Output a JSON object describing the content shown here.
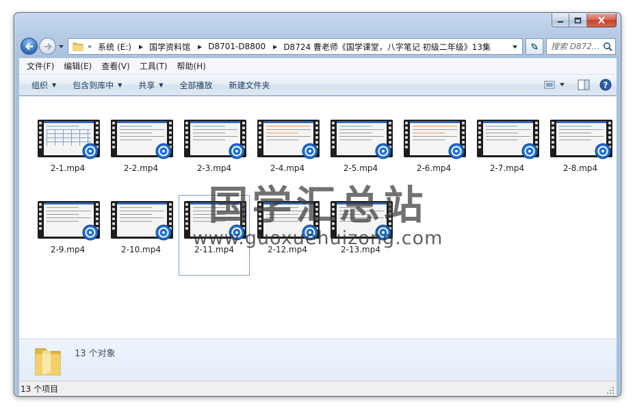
{
  "window": {
    "caption": {
      "minimize": "minimize",
      "maximize": "maximize",
      "close": "close"
    }
  },
  "address": {
    "chevron": "«",
    "crumbs": [
      "系统 (E:)",
      "国学资料馆",
      "D8701-D8800",
      "D8724 曹老师《国学课堂，八字笔记 初级二年级》13集"
    ],
    "search_placeholder": "搜索 D872..."
  },
  "menu": {
    "items": [
      "文件(F)",
      "编辑(E)",
      "查看(V)",
      "工具(T)",
      "帮助(H)"
    ]
  },
  "toolbar": {
    "organize": "组织",
    "include_library": "包含到库中",
    "share": "共享",
    "play_all": "全部播放",
    "new_folder": "新建文件夹"
  },
  "files": [
    {
      "name": "2-1.mp4",
      "style": "grid"
    },
    {
      "name": "2-2.mp4",
      "style": "text"
    },
    {
      "name": "2-3.mp4",
      "style": "text"
    },
    {
      "name": "2-4.mp4",
      "style": "orange"
    },
    {
      "name": "2-5.mp4",
      "style": "text"
    },
    {
      "name": "2-6.mp4",
      "style": "orange"
    },
    {
      "name": "2-7.mp4",
      "style": "text"
    },
    {
      "name": "2-8.mp4",
      "style": "text"
    },
    {
      "name": "2-9.mp4",
      "style": "text"
    },
    {
      "name": "2-10.mp4",
      "style": "text"
    },
    {
      "name": "2-11.mp4",
      "style": "text",
      "selected": true
    },
    {
      "name": "2-12.mp4",
      "style": "text"
    },
    {
      "name": "2-13.mp4",
      "style": "text"
    }
  ],
  "watermark": {
    "title": "国学汇总站",
    "url": "www.guoxuehuizong.com"
  },
  "details": {
    "count_text": "13 个对象"
  },
  "status": {
    "text": "13 个项目"
  },
  "colors": {
    "frame": "#a9c0df",
    "accent": "#2f64b5",
    "badge": "#1d6fd6"
  }
}
